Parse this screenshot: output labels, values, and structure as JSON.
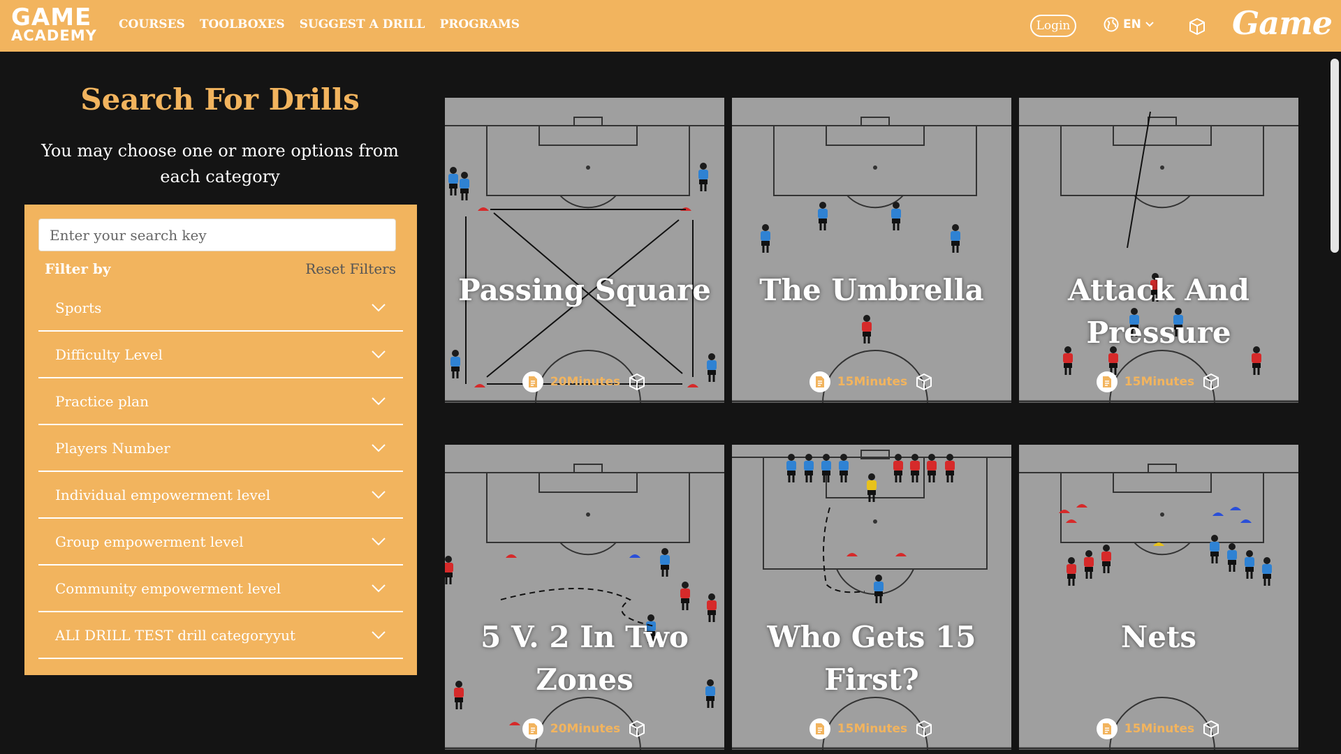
{
  "header": {
    "logo_line1": "GAME",
    "logo_line2": "ACADEMY",
    "nav": [
      "COURSES",
      "TOOLBOXES",
      "SUGGEST A DRILL",
      "PROGRAMS"
    ],
    "login_label": "Login",
    "language": "EN",
    "brand": "Game"
  },
  "sidebar": {
    "title": "Search For Drills",
    "subtitle": "You may choose one or more options from each category",
    "search_placeholder": "Enter your search key",
    "filter_by_label": "Filter by",
    "reset_label": "Reset Filters",
    "filters": [
      "Sports",
      "Difficulty Level",
      "Practice plan",
      "Players Number",
      "Individual empowerment level",
      "Group empowerment level",
      "Community empowerment level",
      "ALI DRILL TEST drill categoryyut"
    ]
  },
  "drills": [
    {
      "title_lines": [
        "Passing Square"
      ],
      "minutes": "20Minutes"
    },
    {
      "title_lines": [
        "The Umbrella"
      ],
      "minutes": "15Minutes"
    },
    {
      "title_lines": [
        "Attack And",
        "Pressure"
      ],
      "minutes": "15Minutes"
    },
    {
      "title_lines": [
        "5 V. 2 In Two",
        "Zones"
      ],
      "minutes": "20Minutes"
    },
    {
      "title_lines": [
        "Who Gets 15",
        "First?"
      ],
      "minutes": "15Minutes"
    },
    {
      "title_lines": [
        "Nets"
      ],
      "minutes": "15Minutes"
    }
  ],
  "colors": {
    "accent": "#f2b45e",
    "background": "#141414",
    "pitch": "#9f9f9f",
    "player_blue": "#2f82d3",
    "player_red": "#d62a2a"
  }
}
